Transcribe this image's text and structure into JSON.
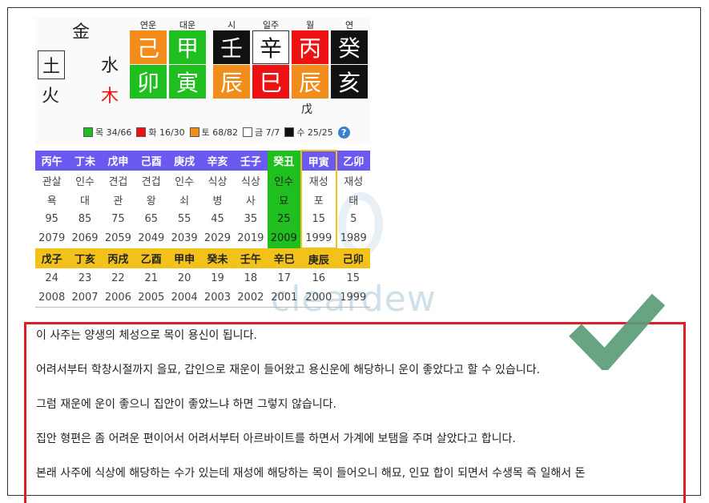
{
  "elements": {
    "boxed": "土",
    "metal": "金",
    "water": "水",
    "fire": "火",
    "wood": "木"
  },
  "pillars": {
    "headers": [
      "연운",
      "대운",
      "시",
      "일주",
      "월",
      "연"
    ],
    "stems": [
      "己",
      "甲",
      "壬",
      "辛",
      "丙",
      "癸"
    ],
    "branches": [
      "卯",
      "寅",
      "辰",
      "巳",
      "辰",
      "亥"
    ],
    "stem_colors": [
      "#f28c1a",
      "#1fbf1f",
      "#111111",
      "#ffffff",
      "#ee1111",
      "#111111"
    ],
    "branch_colors": [
      "#1fbf1f",
      "#1fbf1f",
      "#f28c1a",
      "#ee1111",
      "#f28c1a",
      "#111111"
    ],
    "hidden_stem": "戊"
  },
  "legend": [
    {
      "label": "목 34/66",
      "color": "#1fbf1f"
    },
    {
      "label": "화 16/30",
      "color": "#ee1111"
    },
    {
      "label": "토 68/82",
      "color": "#f28c1a"
    },
    {
      "label": "금 7/7",
      "color": "#ffffff"
    },
    {
      "label": "수 25/25",
      "color": "#111111"
    }
  ],
  "help_icon_label": "?",
  "daeun": {
    "ganji": [
      "丙午",
      "丁未",
      "戊申",
      "己酉",
      "庚戌",
      "辛亥",
      "壬子",
      "癸丑",
      "甲寅",
      "乙卯"
    ],
    "sipsin": [
      "관살",
      "인수",
      "견겁",
      "견겁",
      "인수",
      "식상",
      "식상",
      "인수",
      "재성",
      "재성"
    ],
    "unsung": [
      "욕",
      "대",
      "관",
      "왕",
      "쇠",
      "병",
      "사",
      "묘",
      "포",
      "태"
    ],
    "ages": [
      "95",
      "85",
      "75",
      "65",
      "55",
      "45",
      "35",
      "25",
      "15",
      "5"
    ],
    "years": [
      "2079",
      "2069",
      "2059",
      "2049",
      "2039",
      "2029",
      "2019",
      "2009",
      "1999",
      "1989"
    ]
  },
  "seun": {
    "ganji": [
      "戊子",
      "丁亥",
      "丙戌",
      "乙酉",
      "甲申",
      "癸未",
      "壬午",
      "辛巳",
      "庚辰",
      "己卯"
    ],
    "ages": [
      "24",
      "23",
      "22",
      "21",
      "20",
      "19",
      "18",
      "17",
      "16",
      "15"
    ],
    "years": [
      "2008",
      "2007",
      "2006",
      "2005",
      "2004",
      "2003",
      "2002",
      "2001",
      "2000",
      "1999"
    ]
  },
  "watermark": "cleardew",
  "paragraphs": [
    "이 사주는 양생의 체성으로 목이 용신이 됩니다.",
    "어려서부터 학창시절까지 을묘, 갑인으로 재운이 들어왔고 용신운에 해당하니 운이 좋았다고 할 수 있습니다.",
    "그럼 재운에 운이 좋으니 집안이 좋았느냐 하면 그렇지 않습니다.",
    "집안 형편은 좀 어려운 편이어서 어려서부터 아르바이트를 하면서 가계에 보탬을 주며 살았다고 합니다.",
    "본래 사주에 식상에 해당하는 수가 있는데 재성에 해당하는 목이 들어오니 해묘, 인묘 합이 되면서 수생목 즉 일해서 돈"
  ]
}
